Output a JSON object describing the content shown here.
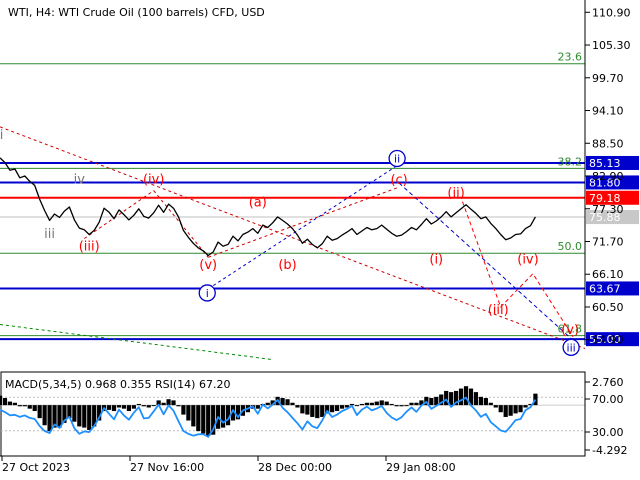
{
  "chart_data": {
    "type": "line",
    "title": "WTI, H4:  WTI Crude Oil (100 barrels) CFD, USD",
    "xlabel": "",
    "ylabel": "",
    "price_axis": {
      "ticks": [
        "110.90",
        "105.30",
        "99.70",
        "94.10",
        "88.50",
        "82.90",
        "77.30",
        "71.70",
        "66.10",
        "60.50",
        "54.90"
      ],
      "ylim": [
        54.0,
        113.0
      ]
    },
    "time_axis": {
      "labels": [
        "27 Oct 2023",
        "27 Nov 16:00",
        "28 Dec 00:00",
        "29 Jan 08:00"
      ],
      "xlim": [
        0,
        118
      ]
    },
    "price_series": {
      "name": "WTI",
      "values": [
        86.0,
        85.2,
        83.9,
        84.1,
        82.6,
        82.9,
        82.0,
        81.3,
        78.9,
        77.0,
        75.3,
        76.4,
        75.8,
        76.9,
        77.6,
        75.4,
        74.0,
        73.7,
        72.9,
        73.6,
        75.0,
        77.4,
        76.7,
        75.6,
        77.1,
        76.3,
        75.4,
        76.2,
        77.3,
        76.0,
        75.7,
        76.6,
        77.9,
        76.7,
        78.1,
        77.4,
        75.9,
        73.6,
        72.4,
        71.4,
        70.6,
        70.1,
        69.3,
        69.9,
        71.6,
        70.9,
        71.2,
        72.6,
        71.8,
        72.9,
        73.3,
        73.9,
        73.1,
        74.5,
        74.1,
        74.9,
        75.9,
        75.3,
        74.7,
        73.9,
        72.8,
        71.4,
        72.1,
        71.2,
        70.6,
        71.3,
        72.6,
        71.9,
        72.2,
        72.8,
        73.3,
        73.9,
        72.9,
        73.5,
        74.1,
        73.7,
        73.9,
        74.5,
        73.8,
        73.1,
        72.6,
        72.8,
        73.4,
        74.1,
        73.7,
        74.6,
        75.6,
        74.7,
        75.2,
        75.9,
        76.8,
        75.9,
        76.6,
        77.3,
        78.0,
        77.2,
        76.5,
        75.6,
        75.9,
        74.8,
        73.9,
        72.9,
        72.0,
        72.3,
        72.9,
        73.0,
        73.9,
        74.4,
        75.9
      ],
      "color": "#000000"
    },
    "levels": {
      "horizontal": [
        {
          "label": "85.13",
          "value": 85.13,
          "color": "#0000cc"
        },
        {
          "label": "81.80",
          "value": 81.8,
          "color": "#0000cc"
        },
        {
          "label": "79.18",
          "value": 79.18,
          "color": "#ff0000"
        },
        {
          "label": "63.67",
          "value": 63.67,
          "color": "#0000cc"
        },
        {
          "label": "55.00",
          "value": 55.0,
          "color": "#0000cc"
        }
      ],
      "fibonacci": [
        {
          "label": "23.6",
          "value": 102.1
        },
        {
          "label": "38.2",
          "value": 84.2
        },
        {
          "label": "50.0",
          "value": 69.7
        },
        {
          "label": "61.8",
          "value": 55.6
        }
      ],
      "current_price": {
        "label": "75.88",
        "value": 75.88
      }
    },
    "wave_labels": [
      {
        "text": "i",
        "x": 0.3,
        "y": 89.2,
        "color": "#777777"
      },
      {
        "text": "iv",
        "x": 16,
        "y": 81.6,
        "color": "#777777"
      },
      {
        "text": "iii",
        "x": 10,
        "y": 72.3,
        "color": "#777777"
      },
      {
        "text": "(iv)",
        "x": 31,
        "y": 81.6,
        "color": "#ff0000"
      },
      {
        "text": "(iii)",
        "x": 18,
        "y": 70.2,
        "color": "#ff0000"
      },
      {
        "text": "(v)",
        "x": 42,
        "y": 67.0,
        "color": "#ff0000"
      },
      {
        "text": "(a)",
        "x": 52,
        "y": 77.7,
        "color": "#ff0000"
      },
      {
        "text": "(b)",
        "x": 58,
        "y": 67.0,
        "color": "#ff0000"
      },
      {
        "text": "(c)",
        "x": 80.5,
        "y": 81.5,
        "color": "#ff0000"
      },
      {
        "text": "(ii)",
        "x": 92,
        "y": 79.3,
        "color": "#ff0000"
      },
      {
        "text": "(i)",
        "x": 88,
        "y": 67.9,
        "color": "#ff0000"
      },
      {
        "text": "(iii)",
        "x": 100.5,
        "y": 59.3,
        "color": "#ff0000"
      },
      {
        "text": "(iv)",
        "x": 106.5,
        "y": 67.9,
        "color": "#ff0000"
      },
      {
        "text": "(v)",
        "x": 115,
        "y": 55.9,
        "color": "#ff0000"
      }
    ],
    "circled_labels": [
      {
        "text": "i",
        "x": 41.8,
        "y": 62.9,
        "color": "#0000cc"
      },
      {
        "text": "ii",
        "x": 80.1,
        "y": 85.9,
        "color": "#0000cc"
      },
      {
        "text": "iii",
        "x": 115.2,
        "y": 53.6,
        "color": "#0000cc"
      }
    ],
    "projection_paths": [
      {
        "color": "#ff0000",
        "points": [
          [
            93.3,
            78.5
          ],
          [
            101,
            60.5
          ],
          [
            107.5,
            66.2
          ],
          [
            115.6,
            55.4
          ]
        ]
      },
      {
        "color": "#0000cc",
        "points": [
          [
            80.5,
            81.7
          ],
          [
            116.5,
            54.1
          ]
        ]
      }
    ],
    "trend_lines": [
      {
        "color": "#cc0000",
        "points": [
          [
            0,
            91.3
          ],
          [
            118,
            53.4
          ]
        ]
      },
      {
        "color": "#cc0000",
        "points": [
          [
            17,
            72.2
          ],
          [
            31,
            80.4
          ]
        ]
      },
      {
        "color": "#cc0000",
        "points": [
          [
            31,
            80.4
          ],
          [
            42,
            69.0
          ]
        ]
      },
      {
        "color": "#cc0000",
        "points": [
          [
            42,
            69.0
          ],
          [
            80.5,
            81.0
          ]
        ]
      },
      {
        "color": "#0000cc",
        "points": [
          [
            42,
            63.6
          ],
          [
            80.5,
            84.9
          ]
        ]
      },
      {
        "color": "#008800",
        "points": [
          [
            0,
            57.5
          ],
          [
            55,
            51.5
          ]
        ]
      }
    ],
    "indicator": {
      "label": "MACD(5,34,5) 0.968 0.355 RSI(14) 67.20",
      "left_axis": {
        "ticks": [
          "2.760",
          "70.00",
          "30.00",
          "-4.292"
        ]
      },
      "rsi_range": [
        0,
        100
      ],
      "rsi_levels": [
        70,
        30
      ],
      "macd_range": [
        -4.3,
        2.8
      ],
      "rsi_values": [
        55.0,
        52.3,
        48.5,
        49.1,
        46.5,
        48.3,
        45.4,
        44.1,
        35.6,
        29.8,
        27.3,
        37.6,
        33.5,
        42.3,
        46.7,
        32.9,
        26.4,
        29.3,
        28.5,
        35.8,
        45.8,
        57.2,
        50.2,
        43.7,
        55.2,
        48.3,
        43.2,
        51.7,
        58.1,
        44.8,
        45.3,
        53.2,
        61.1,
        49.6,
        60.3,
        53.9,
        41.4,
        29.8,
        26.3,
        24.2,
        25.8,
        26.1,
        22.7,
        31.5,
        46.3,
        39.8,
        43.6,
        54.7,
        46.2,
        54.3,
        56.5,
        59.2,
        50.3,
        61.2,
        56.7,
        61.3,
        66.7,
        57.4,
        52.1,
        45.3,
        38.9,
        31.5,
        41.3,
        35.3,
        33.2,
        42.3,
        53.7,
        46.4,
        49.3,
        53.6,
        56.1,
        59.8,
        48.7,
        55.2,
        58.8,
        54.3,
        56.5,
        59.7,
        51.2,
        45.8,
        42.7,
        46.2,
        52.7,
        57.8,
        52.6,
        60.1,
        64.3,
        56.2,
        59.7,
        63.6,
        67.2,
        58.4,
        63.7,
        66.3,
        69.5,
        60.1,
        54.3,
        46.6,
        50.1,
        40.2,
        35.4,
        30.3,
        28.8,
        35.4,
        42.7,
        44.1,
        54.5,
        58.1,
        67.2
      ],
      "macd_values": [
        0.8,
        0.6,
        0.3,
        0.2,
        -0.1,
        -0.1,
        -0.3,
        -0.5,
        -1.1,
        -1.7,
        -2.2,
        -1.9,
        -1.9,
        -1.5,
        -1.1,
        -1.4,
        -1.8,
        -1.9,
        -2.1,
        -1.8,
        -1.3,
        -0.5,
        -0.4,
        -0.5,
        -0.2,
        -0.3,
        -0.5,
        -0.3,
        0.1,
        -0.1,
        -0.2,
        0.0,
        0.4,
        0.2,
        0.5,
        0.4,
        -0.1,
        -0.8,
        -1.3,
        -1.8,
        -2.2,
        -2.4,
        -2.6,
        -2.5,
        -2.0,
        -1.9,
        -1.7,
        -1.3,
        -1.2,
        -0.9,
        -0.6,
        -0.3,
        -0.3,
        0.1,
        0.2,
        0.4,
        0.7,
        0.6,
        0.5,
        0.2,
        -0.2,
        -0.7,
        -0.8,
        -1.0,
        -1.1,
        -1.0,
        -0.7,
        -0.6,
        -0.5,
        -0.3,
        -0.2,
        0.1,
        0.0,
        0.1,
        0.2,
        0.2,
        0.3,
        0.4,
        0.3,
        0.1,
        -0.1,
        -0.1,
        0.0,
        0.2,
        0.2,
        0.4,
        0.7,
        0.6,
        0.7,
        0.9,
        1.2,
        1.1,
        1.2,
        1.4,
        1.6,
        1.4,
        1.1,
        0.7,
        0.6,
        0.2,
        -0.2,
        -0.6,
        -1.0,
        -0.9,
        -0.7,
        -0.6,
        -0.2,
        0.1,
        0.97
      ]
    }
  }
}
